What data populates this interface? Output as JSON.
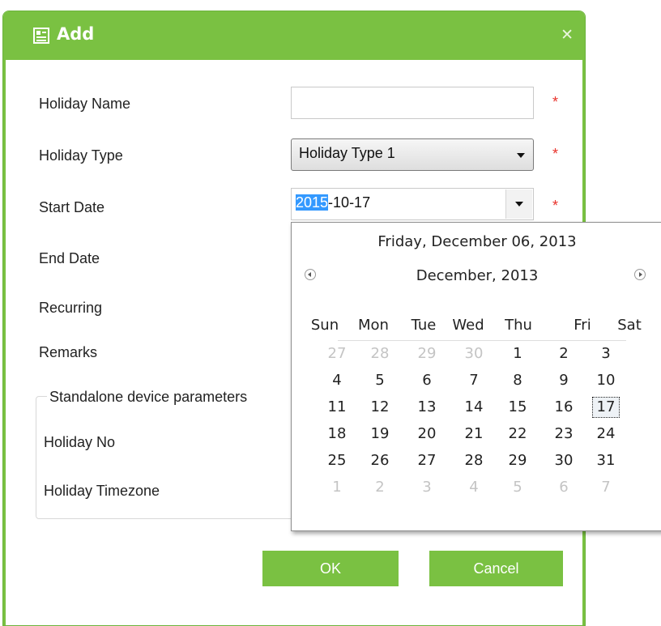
{
  "dialog": {
    "title": "Add",
    "close_icon": "close-icon",
    "accent_color": "#7ac142",
    "required_mark": "*"
  },
  "form": {
    "holiday_name_label": "Holiday Name",
    "holiday_name_value": "",
    "holiday_type_label": "Holiday Type",
    "holiday_type_value": "Holiday Type 1",
    "start_date_label": "Start Date",
    "start_date_selected": "2015",
    "start_date_rest": "-10-17",
    "end_date_label": "End Date",
    "recurring_label": "Recurring",
    "remarks_label": "Remarks",
    "group_title": "Standalone device parameters",
    "holiday_no_label": "Holiday No",
    "holiday_timezone_label": "Holiday Timezone"
  },
  "calendar": {
    "today_text": "Friday, December 06, 2013",
    "month_text": "December, 2013",
    "prev_icon": "arrow-left-icon",
    "next_icon": "arrow-right-icon",
    "weekdays": [
      "Sun",
      "Mon",
      "Tue",
      "Wed",
      "Thu",
      "Fri",
      "Sat"
    ],
    "weeks": [
      [
        "27",
        "28",
        "29",
        "30",
        "1",
        "2",
        "3"
      ],
      [
        "4",
        "5",
        "6",
        "7",
        "8",
        "9",
        "10"
      ],
      [
        "11",
        "12",
        "13",
        "14",
        "15",
        "16",
        "17"
      ],
      [
        "18",
        "19",
        "20",
        "21",
        "22",
        "23",
        "24"
      ],
      [
        "25",
        "26",
        "27",
        "28",
        "29",
        "30",
        "31"
      ],
      [
        "1",
        "2",
        "3",
        "4",
        "5",
        "6",
        "7"
      ]
    ],
    "muted": [
      [
        true,
        true,
        true,
        true,
        false,
        false,
        false
      ],
      [
        false,
        false,
        false,
        false,
        false,
        false,
        false
      ],
      [
        false,
        false,
        false,
        false,
        false,
        false,
        false
      ],
      [
        false,
        false,
        false,
        false,
        false,
        false,
        false
      ],
      [
        false,
        false,
        false,
        false,
        false,
        false,
        false
      ],
      [
        true,
        true,
        true,
        true,
        true,
        true,
        true
      ]
    ],
    "selected_day": "17"
  },
  "buttons": {
    "ok": "OK",
    "cancel": "Cancel"
  }
}
